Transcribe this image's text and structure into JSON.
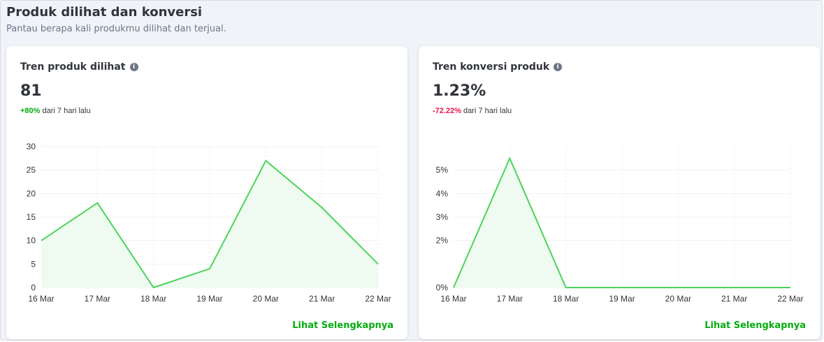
{
  "section": {
    "title": "Produk dilihat dan konversi",
    "subtitle": "Pantau berapa kali produkmu dilihat dan terjual."
  },
  "cards": [
    {
      "title": "Tren produk dilihat",
      "metric": "81",
      "delta": "+80%",
      "delta_suffix": "dari 7 hari lalu",
      "delta_color": "#03ac0e",
      "link": "Lihat Selengkapnya"
    },
    {
      "title": "Tren konversi produk",
      "metric": "1.23%",
      "delta": "-72.22%",
      "delta_suffix": "dari 7 hari lalu",
      "delta_color": "#ef144a",
      "link": "Lihat Selengkapnya"
    }
  ],
  "icons": {
    "info": "info-icon"
  },
  "colors": {
    "line": "#4cd35a",
    "area": "#effbf0",
    "link": "#03ac0e"
  },
  "chart_data": [
    {
      "type": "area",
      "x": [
        "16 Mar",
        "17 Mar",
        "18 Mar",
        "19 Mar",
        "20 Mar",
        "21 Mar",
        "22 Mar"
      ],
      "values": [
        10,
        18,
        0,
        4,
        27,
        17,
        5
      ],
      "yticks": [
        0,
        5,
        10,
        15,
        20,
        25,
        30
      ],
      "ytick_labels": [
        "0",
        "5",
        "10",
        "15",
        "20",
        "25",
        "30"
      ],
      "ylim": [
        0,
        30
      ],
      "grid": true,
      "title": "",
      "xlabel": "",
      "ylabel": ""
    },
    {
      "type": "area",
      "x": [
        "16 Mar",
        "17 Mar",
        "18 Mar",
        "19 Mar",
        "20 Mar",
        "21 Mar",
        "22 Mar"
      ],
      "values": [
        0,
        5.5,
        0,
        0,
        0,
        0,
        0
      ],
      "yticks": [
        0,
        2,
        3,
        4,
        5
      ],
      "ytick_labels": [
        "0%",
        "2%",
        "3%",
        "4%",
        "5%"
      ],
      "ylim": [
        0,
        6
      ],
      "grid": true,
      "title": "",
      "xlabel": "",
      "ylabel": ""
    }
  ]
}
